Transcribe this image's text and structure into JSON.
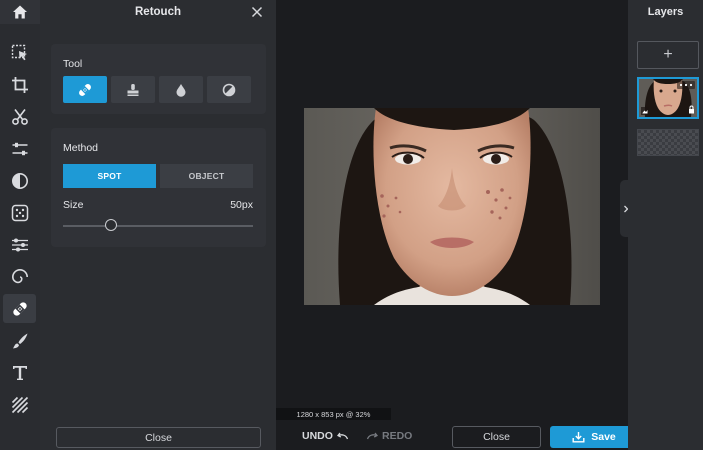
{
  "retouch": {
    "title": "Retouch",
    "tool_label": "Tool",
    "tools": [
      "heal-bandage",
      "clone-stamp",
      "blur-drop",
      "dodge-burn"
    ],
    "active_tool": "heal-bandage",
    "method_label": "Method",
    "method_options": [
      "SPOT",
      "OBJECT"
    ],
    "active_method": "SPOT",
    "size_label": "Size",
    "size_value": "50px",
    "size_fraction": 0.25,
    "close_label": "Close"
  },
  "rail": {
    "tools": [
      "select-arrow",
      "crop",
      "cut",
      "adjust",
      "filter",
      "effects",
      "liquify",
      "swirl",
      "retouch",
      "draw",
      "text",
      "texture"
    ],
    "active": "retouch"
  },
  "canvas": {
    "size_readout": "1280 x 853 px @ 32%"
  },
  "bottombar": {
    "undo_label": "UNDO",
    "redo_label": "REDO",
    "close_label": "Close",
    "save_label": "Save"
  },
  "layers": {
    "title": "Layers",
    "add_label": "+"
  },
  "colors": {
    "accent": "#1e9ad6",
    "panel": "#2b2d31",
    "canvas_bg": "#1b1c1f"
  }
}
